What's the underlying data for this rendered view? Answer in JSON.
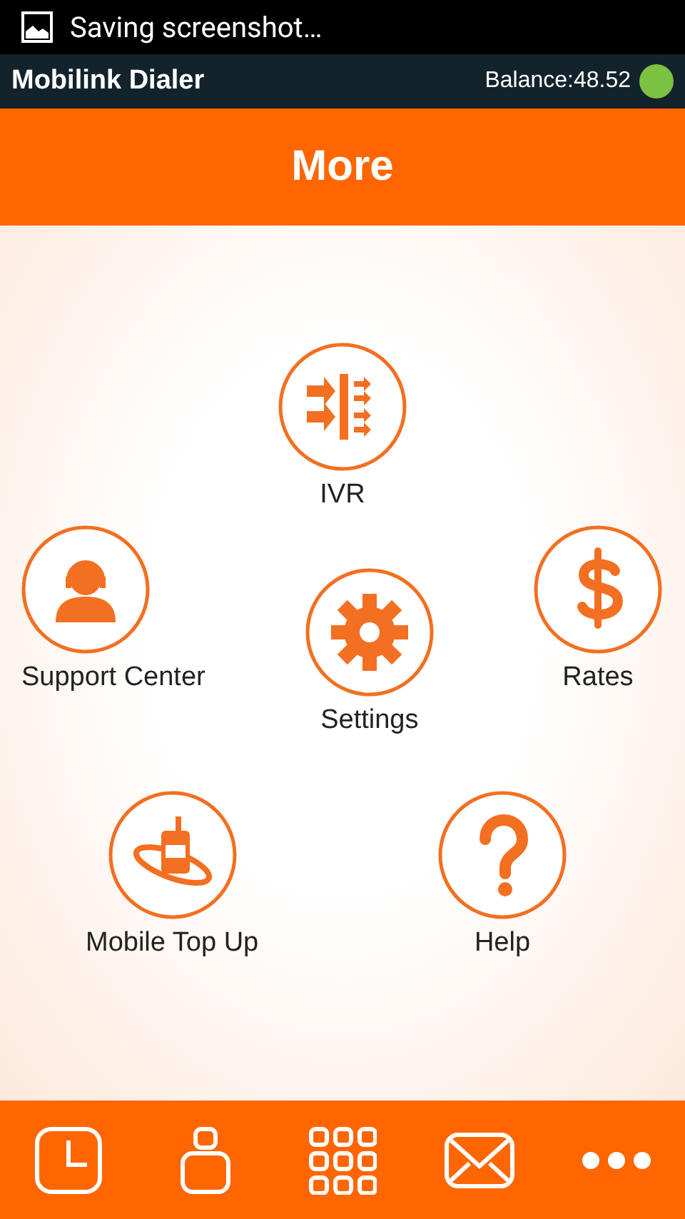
{
  "status_bar": {
    "notification": "Saving screenshot…"
  },
  "app_bar": {
    "title": "Mobilink Dialer",
    "balance": "Balance:48.52"
  },
  "header": {
    "title": "More"
  },
  "menu": [
    {
      "label": "IVR"
    },
    {
      "label": "Support Center"
    },
    {
      "label": "Settings"
    },
    {
      "label": "Rates"
    },
    {
      "label": "Mobile Top Up"
    },
    {
      "label": "Help"
    }
  ]
}
